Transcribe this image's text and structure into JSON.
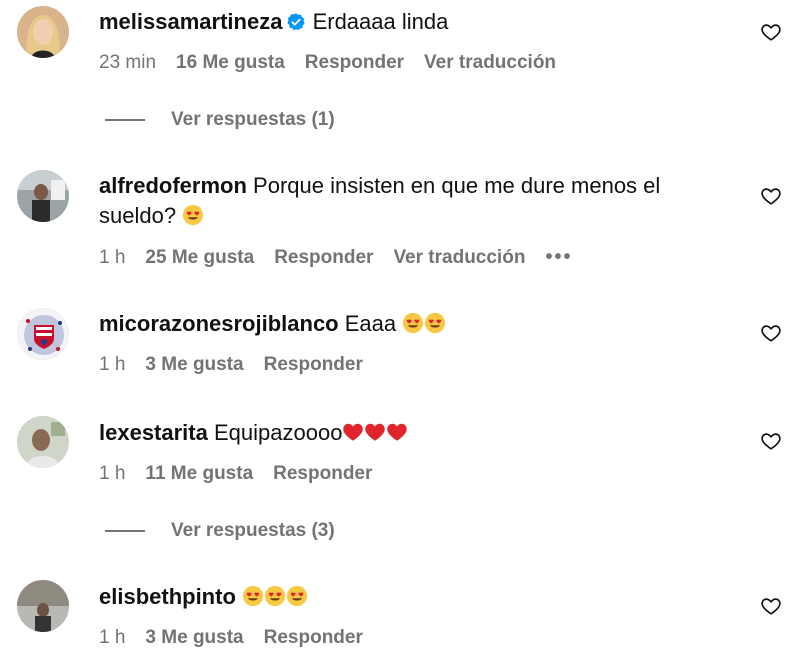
{
  "comments": [
    {
      "username": "melissamartineza",
      "verified": true,
      "text": "Erdaaaa linda",
      "time": "23 min",
      "likes": "16 Me gusta",
      "reply": "Responder",
      "translate": "Ver traducción",
      "view_replies": "Ver respuestas (1)"
    },
    {
      "username": "alfredofermon",
      "text": "Porque insisten en que me dure menos el",
      "text_line2": "sueldo?",
      "emoji": "heart-eyes",
      "time": "1 h",
      "likes": "25 Me gusta",
      "reply": "Responder",
      "translate": "Ver traducción",
      "more": "•••"
    },
    {
      "username": "micorazonesrojiblanco",
      "text": "Eaaa",
      "emoji": "heart-eyes x2",
      "time": "1 h",
      "likes": "3 Me gusta",
      "reply": "Responder"
    },
    {
      "username": "lexestarita",
      "text": "Equipazoooo",
      "emoji": "red-heart x3",
      "time": "1 h",
      "likes": "11 Me gusta",
      "reply": "Responder",
      "view_replies": "Ver respuestas (3)"
    },
    {
      "username": "elisbethpinto",
      "text": "",
      "emoji": "heart-eyes x3",
      "time": "1 h",
      "likes": "3 Me gusta",
      "reply": "Responder"
    }
  ],
  "colors": {
    "text": "#111111",
    "muted": "#737373",
    "verified": "#0095f6",
    "heart_red": "#e0242c",
    "emoji_yellow": "#f7c843"
  }
}
